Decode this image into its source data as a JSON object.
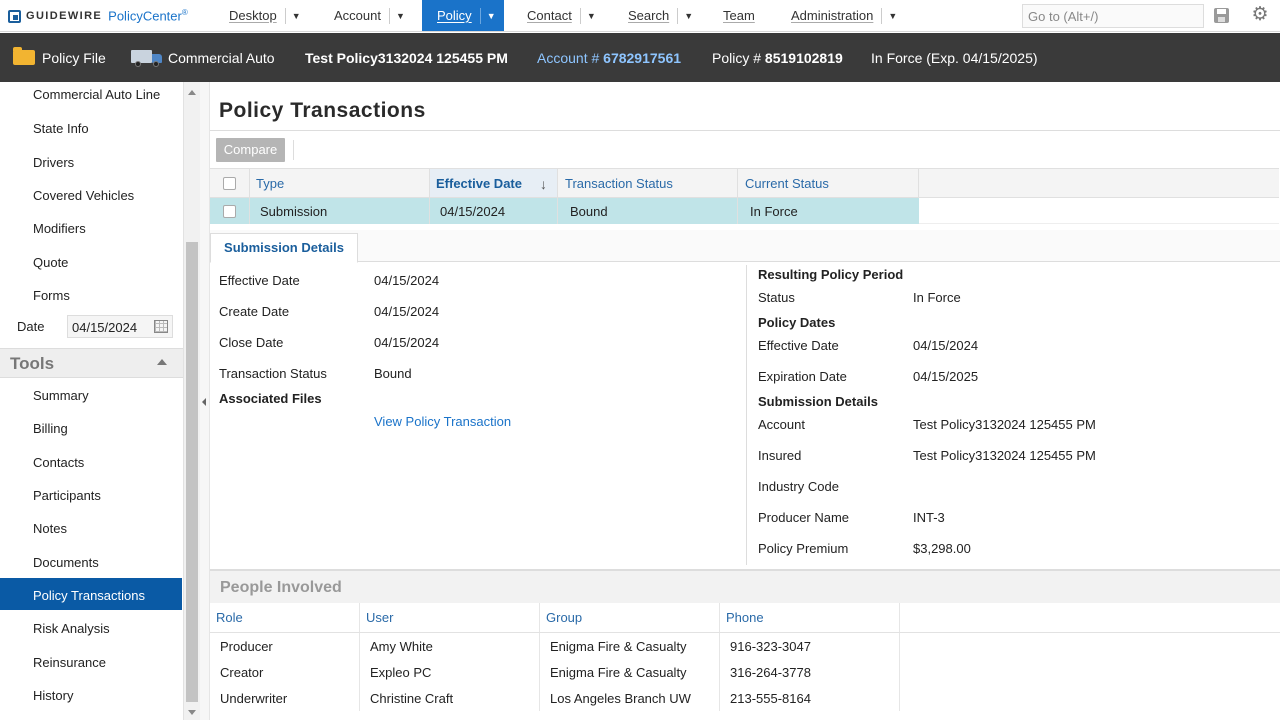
{
  "app": {
    "brand": "GUIDEWIRE",
    "product": "PolicyCenter",
    "mark": "®"
  },
  "nav": {
    "items": [
      {
        "label": "Desktop",
        "caret": "▼"
      },
      {
        "label": "Account",
        "caret": "▼"
      },
      {
        "label": "Policy",
        "caret": "▼"
      },
      {
        "label": "Contact",
        "caret": "▼"
      },
      {
        "label": "Search",
        "caret": "▼"
      },
      {
        "label": "Team"
      },
      {
        "label": "Administration",
        "caret": "▼"
      }
    ],
    "active": "Policy",
    "goto_placeholder": "Go to (Alt+/)"
  },
  "infobar": {
    "policy_file": "Policy File",
    "line": "Commercial Auto",
    "insured": "Test Policy3132024 125455 PM",
    "account_label": "Account #",
    "account_number": "6782917561",
    "policy_label": "Policy #",
    "policy_number": "8519102819",
    "status": "In Force (Exp. 04/15/2025)"
  },
  "sidebar": {
    "items": [
      "Commercial Auto Line",
      "State Info",
      "Drivers",
      "Covered Vehicles",
      "Modifiers",
      "Quote",
      "Forms"
    ],
    "date_label": "Date",
    "date_value": "04/15/2024",
    "tools_title": "Tools",
    "tools": [
      "Summary",
      "Billing",
      "Contacts",
      "Participants",
      "Notes",
      "Documents",
      "Policy Transactions",
      "Risk Analysis",
      "Reinsurance",
      "History"
    ],
    "active": "Policy Transactions"
  },
  "page": {
    "title": "Policy Transactions",
    "compare_label": "Compare"
  },
  "transactions": {
    "headers": [
      "Type",
      "Effective Date",
      "Transaction Status",
      "Current Status"
    ],
    "sort_arrow": "↓",
    "rows": [
      {
        "type": "Submission",
        "effective_date": "04/15/2024",
        "transaction_status": "Bound",
        "current_status": "In Force"
      }
    ]
  },
  "details": {
    "tab": "Submission Details",
    "left": [
      {
        "label": "Effective Date",
        "value": "04/15/2024"
      },
      {
        "label": "Create Date",
        "value": "04/15/2024"
      },
      {
        "label": "Close Date",
        "value": "04/15/2024"
      },
      {
        "label": "Transaction Status",
        "value": "Bound"
      }
    ],
    "associated_files_title": "Associated Files",
    "view_link": "View Policy Transaction",
    "resulting_title": "Resulting Policy Period",
    "status_label": "Status",
    "status_value": "In Force",
    "policy_dates_title": "Policy Dates",
    "effective_label": "Effective Date",
    "effective_value": "04/15/2024",
    "expiration_label": "Expiration Date",
    "expiration_value": "04/15/2025",
    "submission_title": "Submission Details",
    "account_label": "Account",
    "account_value": "Test Policy3132024 125455 PM",
    "insured_label": "Insured",
    "insured_value": "Test Policy3132024 125455 PM",
    "industry_label": "Industry Code",
    "industry_value": "",
    "producer_label": "Producer Name",
    "producer_value": "INT-3",
    "premium_label": "Policy Premium",
    "premium_value": "$3,298.00"
  },
  "people": {
    "title": "People Involved",
    "headers": [
      "Role",
      "User",
      "Group",
      "Phone"
    ],
    "rows": [
      {
        "role": "Producer",
        "user": "Amy White",
        "group": "Enigma Fire & Casualty",
        "phone": "916-323-3047"
      },
      {
        "role": "Creator",
        "user": "Expleo PC",
        "group": "Enigma Fire & Casualty",
        "phone": "316-264-3778"
      },
      {
        "role": "Underwriter",
        "user": "Christine Craft",
        "group": "Los Angeles Branch UW",
        "phone": "213-555-8164"
      }
    ]
  },
  "colors": {
    "accent": "#1a73c9",
    "selected_row": "#c0e4e8",
    "infobar_bg": "#3a3a3a",
    "sidebar_active": "#0a5aa5"
  }
}
